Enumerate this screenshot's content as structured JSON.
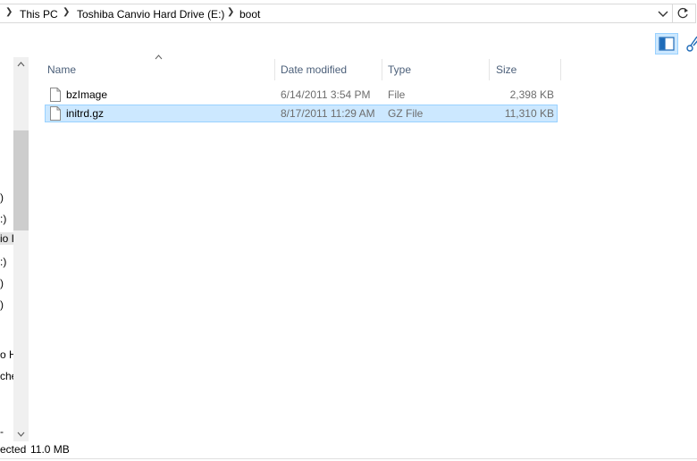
{
  "address": {
    "crumbs": [
      "This PC",
      "Toshiba Canvio Hard Drive (E:)",
      "boot"
    ]
  },
  "nav_pane": {
    "items": [
      ")",
      ":)",
      "io I",
      ":)",
      ")",
      ")",
      "o H",
      "che",
      "-"
    ]
  },
  "columns": {
    "name": "Name",
    "date_modified": "Date modified",
    "type": "Type",
    "size": "Size"
  },
  "files": [
    {
      "name": "bzImage",
      "date": "6/14/2011 3:54 PM",
      "type": "File",
      "size": "2,398 KB",
      "selected": false
    },
    {
      "name": "initrd.gz",
      "date": "8/17/2011 11:29 AM",
      "type": "GZ File",
      "size": "11,310 KB",
      "selected": true
    }
  ],
  "status": {
    "selected_text": "ected",
    "selected_size": "11.0 MB"
  },
  "colors": {
    "selection_bg": "#cce8ff",
    "selection_border": "#99d1ff",
    "header_text": "#4c607a"
  }
}
